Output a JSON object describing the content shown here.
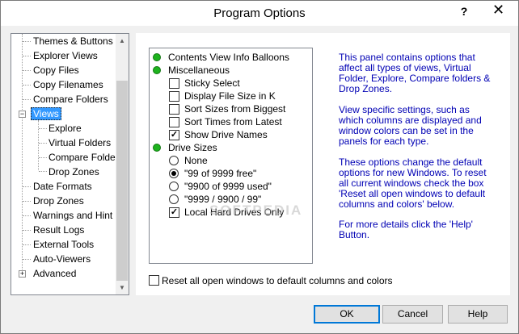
{
  "window": {
    "title": "Program Options",
    "help_glyph": "?",
    "close_glyph": "✕"
  },
  "tree": {
    "items": [
      {
        "label": "Themes & Buttons",
        "level": 1
      },
      {
        "label": "Explorer Views",
        "level": 1
      },
      {
        "label": "Copy Files",
        "level": 1
      },
      {
        "label": "Copy Filenames",
        "level": 1
      },
      {
        "label": "Compare Folders",
        "level": 1
      },
      {
        "label": "Views",
        "level": 0,
        "selected": true,
        "expander": "−"
      },
      {
        "label": "Explore",
        "level": 2
      },
      {
        "label": "Virtual Folders",
        "level": 2
      },
      {
        "label": "Compare Folde",
        "level": 2
      },
      {
        "label": "Drop Zones",
        "level": 2
      },
      {
        "label": "Date Formats",
        "level": 1
      },
      {
        "label": "Drop Zones",
        "level": 1
      },
      {
        "label": "Warnings and Hint",
        "level": 1
      },
      {
        "label": "Result Logs",
        "level": 1
      },
      {
        "label": "External Tools",
        "level": 1
      },
      {
        "label": "Auto-Viewers",
        "level": 1
      },
      {
        "label": "Advanced",
        "level": 0,
        "expander": "+"
      }
    ]
  },
  "options": {
    "contents_view": "Contents View Info Balloons",
    "misc": "Miscellaneous",
    "sticky_select": {
      "label": "Sticky Select",
      "checked": false
    },
    "display_size_k": {
      "label": "Display File Size in K",
      "checked": false
    },
    "sort_sizes": {
      "label": "Sort Sizes from Biggest",
      "checked": false
    },
    "sort_times": {
      "label": "Sort Times from Latest",
      "checked": false
    },
    "show_drives": {
      "label": "Show Drive Names",
      "checked": true
    },
    "drive_sizes": "Drive Sizes",
    "radio_none": {
      "label": "None",
      "selected": false
    },
    "radio_free": {
      "label": "\"99 of 9999 free\"",
      "selected": true
    },
    "radio_used": {
      "label": "\"9900 of 9999 used\"",
      "selected": false
    },
    "radio_slash": {
      "label": "\"9999 / 9900 / 99\"",
      "selected": false
    },
    "local_hd": {
      "label": "Local Hard Drives Only",
      "checked": true
    },
    "check_mark": "✓"
  },
  "info": {
    "p1": "This panel contains options that affect all types of views, Virtual Folder, Explore, Compare folders & Drop Zones.",
    "p2": "View specific settings, such as which columns are displayed and window colors can be set in the panels for each type.",
    "p3": "These options change the default options for new Windows. To reset all current windows check the box 'Reset all open windows to default columns and colors' below.",
    "p4": "For more details click the 'Help' Button."
  },
  "watermark": "SOFTPEDIA",
  "reset": {
    "label": "Reset all open windows to default columns and colors",
    "checked": false
  },
  "buttons": {
    "ok": "OK",
    "cancel": "Cancel",
    "help": "Help"
  },
  "scroll": {
    "up": "▲",
    "down": "▼"
  }
}
